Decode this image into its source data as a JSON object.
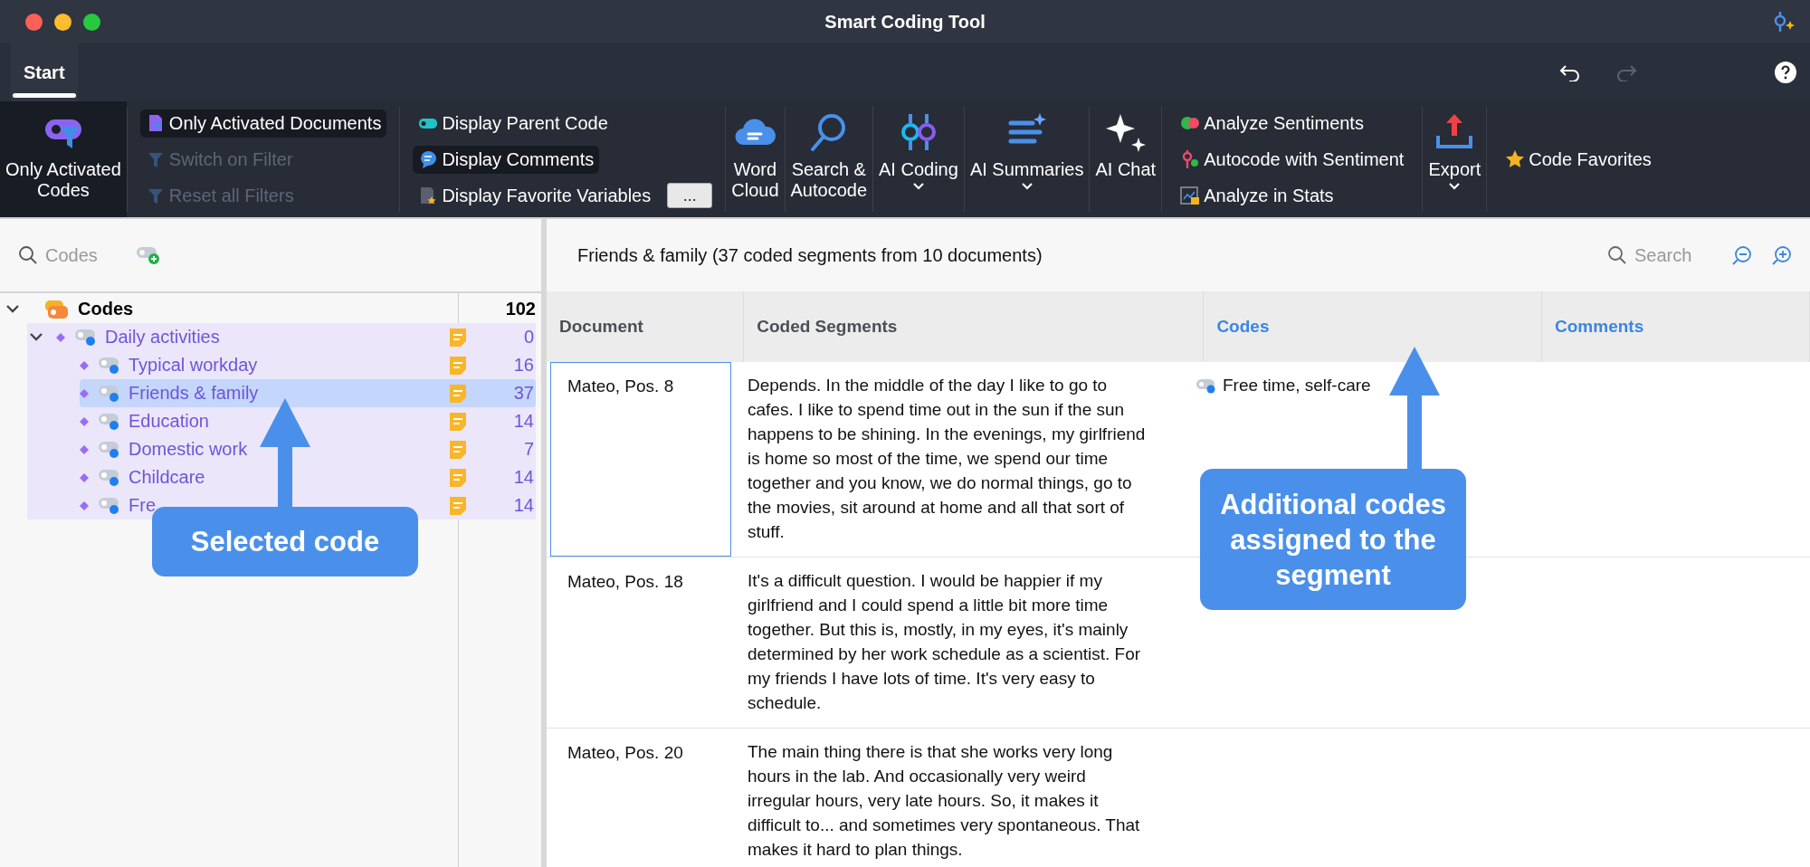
{
  "window": {
    "title": "Smart Coding Tool"
  },
  "tabs": [
    {
      "label": "Start",
      "selected": true
    }
  ],
  "toolbar": {
    "undo": {
      "disabled": false
    },
    "redo": {
      "disabled": true
    }
  },
  "ribbon": [
    {
      "kind": "large",
      "lines": [
        "Only Activated",
        "Codes"
      ],
      "active": true,
      "dropdown": false
    },
    {
      "kind": "stack",
      "items": [
        {
          "label": "Only Activated Documents",
          "active": true,
          "disabled": false
        },
        {
          "label": "Switch on Filter",
          "active": false,
          "disabled": true
        },
        {
          "label": "Reset all Filters",
          "active": false,
          "disabled": true
        }
      ]
    },
    {
      "kind": "stack",
      "items": [
        {
          "label": "Display Parent Code",
          "active": false,
          "disabled": false
        },
        {
          "label": "Display Comments",
          "active": true,
          "disabled": false
        },
        {
          "label": "Display Favorite Variables",
          "active": false,
          "disabled": false,
          "more": "..."
        }
      ]
    },
    {
      "kind": "large",
      "lines": [
        "Word",
        "Cloud"
      ],
      "active": false,
      "dropdown": false
    },
    {
      "kind": "large",
      "lines": [
        "Search &",
        "Autocode"
      ],
      "active": false,
      "dropdown": false
    },
    {
      "kind": "large",
      "lines": [
        "AI Coding"
      ],
      "active": false,
      "dropdown": true
    },
    {
      "kind": "large",
      "lines": [
        "AI Summaries"
      ],
      "active": false,
      "dropdown": true
    },
    {
      "kind": "large",
      "lines": [
        "AI Chat"
      ],
      "active": false,
      "dropdown": false
    },
    {
      "kind": "stack",
      "items": [
        {
          "label": "Analyze Sentiments",
          "active": false,
          "disabled": false
        },
        {
          "label": "Autocode with Sentiment",
          "active": false,
          "disabled": false
        },
        {
          "label": "Analyze in Stats",
          "active": false,
          "disabled": false
        }
      ]
    },
    {
      "kind": "large",
      "lines": [
        "Export"
      ],
      "active": false,
      "dropdown": true
    },
    {
      "kind": "stack",
      "items": [
        {
          "label": "Code Favorites",
          "active": false,
          "disabled": false
        }
      ]
    }
  ],
  "code_search": {
    "placeholder": "Codes"
  },
  "code_tree": {
    "label": "Codes",
    "count": "102",
    "expanded": true,
    "children": [
      {
        "label": "Daily activities",
        "count": "0",
        "expanded": true,
        "selected": false,
        "children": [
          {
            "label": "Typical workday",
            "count": "16",
            "selected": false
          },
          {
            "label": "Friends & family",
            "count": "37",
            "selected": true
          },
          {
            "label": "Education",
            "count": "14",
            "selected": false
          },
          {
            "label": "Domestic work",
            "count": "7",
            "selected": false
          },
          {
            "label": "Childcare",
            "count": "14",
            "selected": false
          },
          {
            "label": "Fre",
            "count": "14",
            "selected": false
          }
        ]
      }
    ]
  },
  "segments": {
    "title": "Friends & family (37 coded segments from 10 documents)",
    "search": {
      "placeholder": "Search"
    },
    "columns": [
      {
        "label": "Document",
        "accent": false
      },
      {
        "label": "Coded Segments",
        "accent": false
      },
      {
        "label": "Codes",
        "accent": true
      },
      {
        "label": "Comments",
        "accent": true
      }
    ],
    "rows": [
      {
        "document": "Mateo, Pos. 8",
        "focused": true,
        "segment": "Depends. In the middle of the day I like to go to cafes. I like to spend time out in the sun if the sun happens to be shining. In the evenings, my girlfriend is home so most of the time, we spend our time together and you know, we do normal things, go to the movies, sit around at home and all that sort of stuff.",
        "codes": [
          "Free time, self-care"
        ]
      },
      {
        "document": "Mateo, Pos. 18",
        "focused": false,
        "segment": "It's a difficult question. I would be happier if my girlfriend and I could spend a little bit more time together. But this is, mostly, in my eyes, it's mainly determined by her work schedule as a scientist. For my friends I have lots of time. It's very easy to schedule."
      },
      {
        "document": "Mateo, Pos. 20",
        "focused": false,
        "segment": "The main thing there is that she works very long hours in the lab. And occasionally very weird irregular hours, very late hours. So, it makes it difficult to... and sometimes very spontaneous. That makes it hard to plan things."
      }
    ]
  },
  "callouts": [
    {
      "text": "Selected code"
    },
    {
      "text": "Additional codes assigned to the segment"
    }
  ]
}
